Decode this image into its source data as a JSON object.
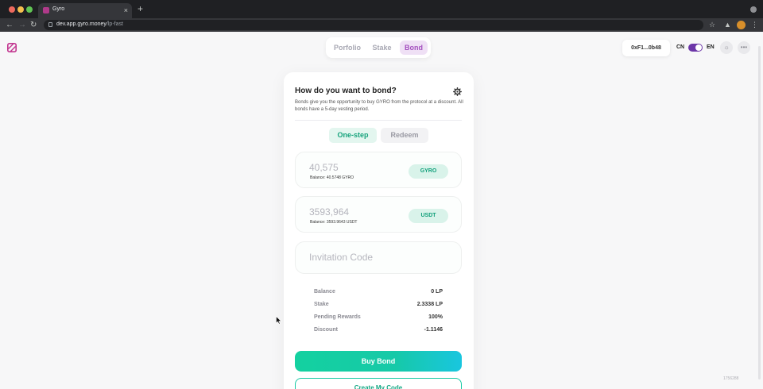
{
  "browser": {
    "tab_title": "Gyro",
    "tab_close": "×",
    "new_tab": "+",
    "url_host": "dev.app.gyro.money",
    "url_path": "/lp-fast"
  },
  "nav": {
    "items": [
      {
        "label": "Porfolio",
        "active": false
      },
      {
        "label": "Stake",
        "active": false
      },
      {
        "label": "Bond",
        "active": true
      }
    ]
  },
  "header": {
    "wallet_address": "0xF1...0b48",
    "lang_left": "CN",
    "lang_right": "EN",
    "more_glyph": "•••"
  },
  "bond_card": {
    "title": "How do you want to bond?",
    "description": "Bonds give you the opportunity to buy GYRO from the protocol at a discount. All bonds have a 5-day vesting period.",
    "tabs": [
      "One-step",
      "Redeem"
    ],
    "inputs": [
      {
        "value": "40,575",
        "balance": "Balance: 40.5748 GYRO",
        "token": "GYRO"
      },
      {
        "value": "3593,964",
        "balance": "Balance: 3593.9643 USDT",
        "token": "USDT"
      }
    ],
    "invitation_placeholder": "Invitation Code",
    "stats": [
      {
        "label": "Balance",
        "value": "0 LP"
      },
      {
        "label": "Stake",
        "value": "2.3338 LP"
      },
      {
        "label": "Pending Rewards",
        "value": "100%"
      },
      {
        "label": "Discount",
        "value": "-1.1146"
      }
    ],
    "buy_label": "Buy Bond",
    "create_code_label": "Create My Code"
  },
  "watermark": "1756288",
  "colors": {
    "accent_purple": "#a44fbf",
    "accent_green": "#14c9a3",
    "toggle": "#6c36a8"
  }
}
